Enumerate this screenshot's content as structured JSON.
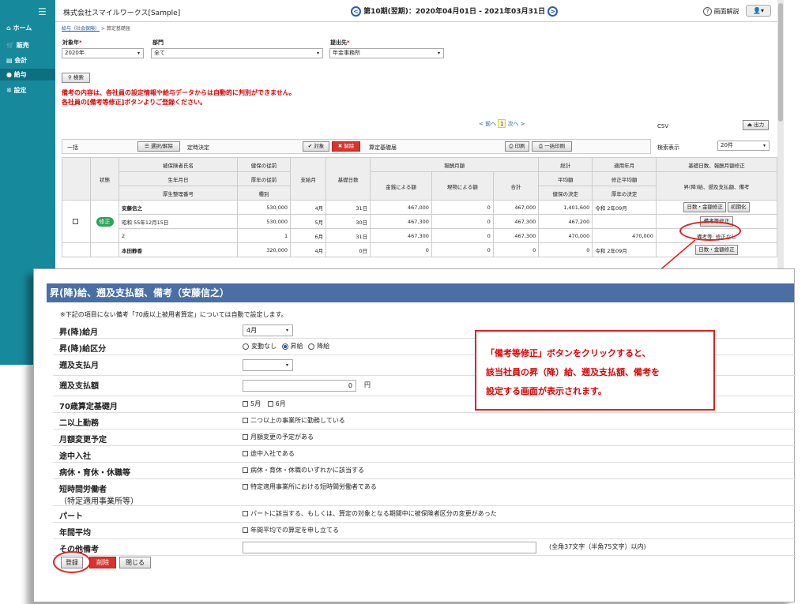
{
  "sidebar": {
    "items": [
      {
        "label": "ホーム",
        "icon": "home-icon"
      },
      {
        "label": "販売",
        "icon": "cart-icon"
      },
      {
        "label": "会計",
        "icon": "ledger-icon"
      },
      {
        "label": "給与",
        "icon": "money-bag-icon"
      },
      {
        "label": "設定",
        "icon": "gear-icon"
      }
    ],
    "active_index": 3
  },
  "header": {
    "company": "株式会社スマイルワークス[Sample]",
    "prev": "<",
    "period": "第10期(翌期)：2020年04月01日 - 2021年03月31日",
    "next": ">",
    "help": "画面解説",
    "help_icon": "?"
  },
  "breadcrumb": {
    "link": "給与（社会保険）",
    "sep": ">",
    "current": "算定基礎届"
  },
  "filters": {
    "year_label": "対象年",
    "year_value": "2020年",
    "dept_label": "部門",
    "dept_value": "全て",
    "dest_label": "提出先",
    "dest_value": "年金事務所",
    "required": "*"
  },
  "search_button": "検索",
  "warning": [
    "備考の内容は、各社員の設定情報や給与データからは自動的に判別ができません。",
    "各社員の[備考等修正]ボタンよりご登録ください。"
  ],
  "pager": {
    "prev": "< 前へ",
    "page": "1",
    "next": "次へ >"
  },
  "csv": {
    "label": "CSV",
    "button": "出力"
  },
  "toolbar": {
    "bulk": "一括",
    "select_toggle": "選択/解除",
    "decision": "定時決定",
    "target_btn": "✔ 対象",
    "cancel_btn": "✖ 解除",
    "doc": "算定基礎届",
    "print": "印刷",
    "bulk_print": "一括印刷",
    "display_count_label": "検索表示",
    "display_count": "20件"
  },
  "table": {
    "head": {
      "status": "状態",
      "name": "被保険者氏名",
      "birth": "生年月日",
      "pension_no": "厚生整理番号",
      "health_before": "健保の従前",
      "pension_before": "厚年の従前",
      "kind": "種別",
      "pay_month": "支給月",
      "base_days": "基礎日数",
      "remuneration": "報酬月額",
      "cash": "金銭による額",
      "goods": "現物による額",
      "total": "合計",
      "sum": "総計",
      "avg": "平均額",
      "health_decided": "健保の決定",
      "apply": "適用年月",
      "mod_avg": "修正平均額",
      "pension_decided": "厚年の決定",
      "fix_head": "基礎日数、報酬月額修正",
      "fix_sub": "昇(降)給、遡及支払額、備考"
    },
    "rows": [
      {
        "name": "安藤信之",
        "hb": "530,000",
        "m": "4月",
        "d": "31日",
        "cash": "467,000",
        "goods": "0",
        "tot": "467,000",
        "sum": "1,401,600",
        "apply": "令和 2年09月",
        "b1": "日数・金額修正",
        "b2": "初期化"
      },
      {
        "status": "修正",
        "name": "昭和 55年12月15日",
        "hb": "530,000",
        "m": "5月",
        "d": "30日",
        "cash": "467,300",
        "goods": "0",
        "tot": "467,300",
        "sum": "467,200",
        "b1": "備考等修正"
      },
      {
        "name": "2",
        "hb": "1",
        "m": "6月",
        "d": "31日",
        "cash": "467,300",
        "goods": "0",
        "tot": "467,300",
        "sum": "470,000",
        "mod": "470,000",
        "note": "備考等: 修正なし"
      },
      {
        "name": "本田静香",
        "hb": "320,000",
        "m": "4月",
        "d": "0日",
        "cash": "0",
        "goods": "0",
        "tot": "0",
        "sum": "0",
        "apply": "令和 2年09月",
        "b1": "日数・金額修正"
      }
    ]
  },
  "dialog": {
    "title": "昇(降)給、遡及支払額、備考（安藤信之）",
    "note": "※下記の項目にない備考「70歳以上被用者算定」については自動で設定します。",
    "fields": {
      "raise_month": {
        "label": "昇(降)給月",
        "value": "4月"
      },
      "raise_kind": {
        "label": "昇(降)給区分",
        "opt1": "変動なし",
        "opt2": "昇給",
        "opt3": "降給"
      },
      "retro_month": {
        "label": "遡及支払月",
        "value": ""
      },
      "retro_amount": {
        "label": "遡及支払額",
        "value": "0",
        "unit": "円"
      },
      "age70": {
        "label": "70歳算定基礎月",
        "opt1": "5月",
        "opt2": "6月"
      },
      "multi": {
        "label": "二以上勤務",
        "text": "二つ以上の事業所に勤務している"
      },
      "monthly_change": {
        "label": "月額変更予定",
        "text": "月額変更の予定がある"
      },
      "midjoin": {
        "label": "途中入社",
        "text": "途中入社である"
      },
      "leave": {
        "label": "病休・育休・休職等",
        "text": "病休・育休・休職のいずれかに該当する"
      },
      "short": {
        "label": "短時間労働者",
        "label2": "（特定適用事業所等）",
        "text": "特定適用事業所における短時間労働者である"
      },
      "part": {
        "label": "パート",
        "text": "パートに該当する、もしくは、算定の対象となる期間中に被保険者区分の変更があった"
      },
      "annual": {
        "label": "年間平均",
        "text": "年間平均での算定を申し立てる"
      },
      "other": {
        "label": "その他備考",
        "value": "",
        "hint": "(全角37文字（半角75文字）以内)"
      }
    },
    "buttons": {
      "register": "登録",
      "delete": "削除",
      "close": "閉じる"
    }
  },
  "callout": [
    "「備考等修正」ボタンをクリックすると、",
    "該当社員の昇（降）給、遡及支払額、備考を",
    "設定する画面が表示されます。"
  ],
  "colors": {
    "sidebar": "#17899c",
    "dialog_title": "#4a6fa5",
    "accent_red": "#e02020",
    "badge": "#2ca25b"
  }
}
